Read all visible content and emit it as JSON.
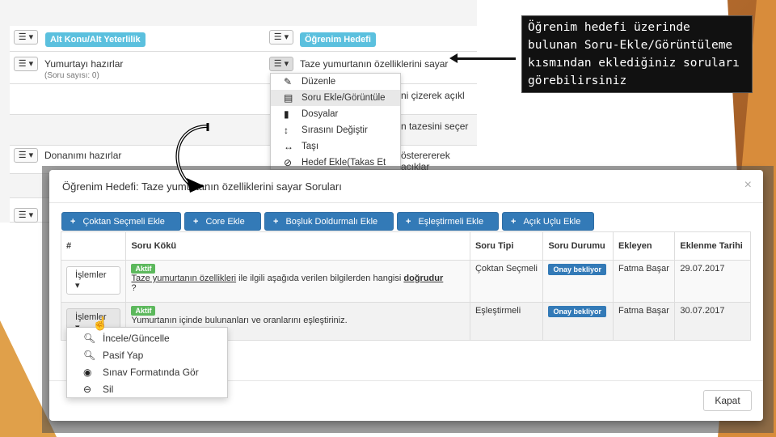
{
  "background": {
    "col1_header": "Alt Konu/Alt Yeterlilik",
    "col2_header": "Öğrenim Hedefi",
    "rows": [
      {
        "title": "Yumurtayı hazırlar",
        "sub": "(Soru sayısı: 0)",
        "right": "Taze yumurtanın özelliklerini sayar"
      },
      {
        "title": "",
        "sub": "",
        "right": "ni çizerek açıkl"
      },
      {
        "title": "",
        "sub": "",
        "right": "n tazesini seçer"
      },
      {
        "title": "Donanımı hazırlar",
        "sub": "",
        "right": "österererek açıklar"
      }
    ],
    "context_menu": [
      "Düzenle",
      "Soru Ekle/Görüntüle",
      "Dosyalar",
      "Sırasını Değiştir",
      "Taşı",
      "Hedef Ekle(Takas Et"
    ]
  },
  "callout": {
    "text": "Öğrenim hedefi üzerinde bulunan Soru-Ekle/Görüntüleme kısmından eklediğiniz soruları görebilirsiniz"
  },
  "modal": {
    "title": "Öğrenim Hedefi: Taze yumurtanın özelliklerini sayar Soruları",
    "close": "×",
    "toolbar": [
      "Çoktan Seçmeli Ekle",
      "Core Ekle",
      "Boşluk Doldurmalı Ekle",
      "Eşleştirmeli Ekle",
      "Açık Uçlu Ekle"
    ],
    "columns": [
      "#",
      "Soru Kökü",
      "Soru Tipi",
      "Soru Durumu",
      "Ekleyen",
      "Eklenme Tarihi"
    ],
    "rows": [
      {
        "action": "İşlemler",
        "status_badge": "Aktif",
        "stem_link": "Taze yumurtanın özellikleri",
        "stem_text": " ile ilgili aşağıda verilen bilgilerden hangisi ",
        "stem_bold": "doğrudur",
        "stem_end": "?",
        "type": "Çoktan Seçmeli",
        "state": "Onay bekliyor",
        "author": "Fatma Başar",
        "date": "29.07.2017"
      },
      {
        "action": "İşlemler",
        "status_badge": "Aktif",
        "stem_link": "",
        "stem_text": "Yumurtanın içinde bulunanları ve oranlarını eşleştiriniz.",
        "stem_bold": "",
        "stem_end": "",
        "type": "Eşleştirmeli",
        "state": "Onay bekliyor",
        "author": "Fatma Başar",
        "date": "30.07.2017"
      }
    ],
    "row_menu": [
      "İncele/Güncelle",
      "Pasif Yap",
      "Sınav Formatında Gör",
      "Sil"
    ],
    "footer_button": "Kapat"
  },
  "colors": {
    "primary": "#337ab7",
    "success": "#5cb85c",
    "info": "#5bc0de"
  }
}
